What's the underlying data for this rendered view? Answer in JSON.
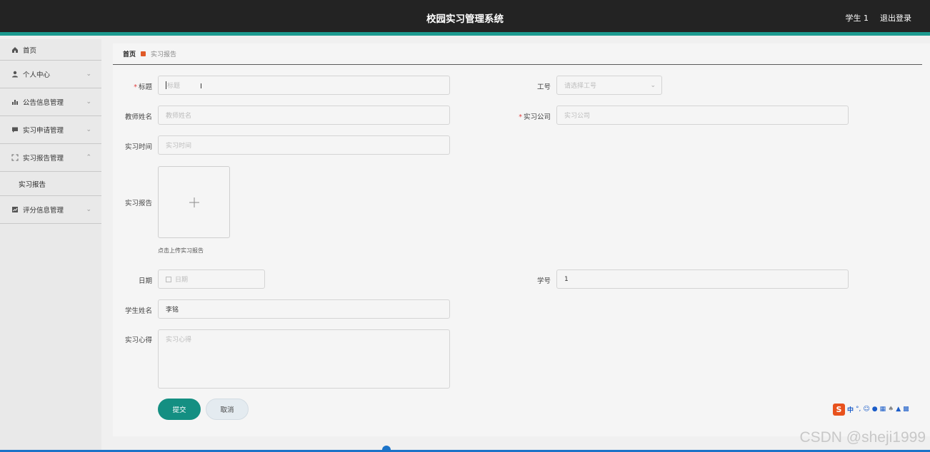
{
  "header": {
    "title": "校园实习管理系统",
    "user": "学生 1",
    "logout": "退出登录"
  },
  "sidebar": {
    "items": [
      {
        "label": "首页",
        "icon": "home-icon"
      },
      {
        "label": "个人中心",
        "icon": "user-icon"
      },
      {
        "label": "公告信息管理",
        "icon": "bar-chart-icon"
      },
      {
        "label": "实习申请管理",
        "icon": "message-icon"
      },
      {
        "label": "实习报告管理",
        "icon": "fullscreen-icon"
      },
      {
        "label": "实习报告"
      },
      {
        "label": "评分信息管理",
        "icon": "chart-icon"
      }
    ]
  },
  "breadcrumb": {
    "home": "首页",
    "current": "实习报告"
  },
  "form": {
    "title_label": "标题",
    "title_placeholder": "标题",
    "job_no_label": "工号",
    "job_no_placeholder": "请选择工号",
    "teacher_label": "教师姓名",
    "teacher_placeholder": "教师姓名",
    "company_label": "实习公司",
    "company_placeholder": "实习公司",
    "time_label": "实习时间",
    "time_placeholder": "实习时间",
    "report_label": "实习报告",
    "upload_hint": "点击上传实习报告",
    "date_label": "日期",
    "date_placeholder": "日期",
    "student_no_label": "学号",
    "student_no_value": "1",
    "student_name_label": "学生姓名",
    "student_name_value": "李铭",
    "experience_label": "实习心得",
    "experience_placeholder": "实习心得",
    "submit": "提交",
    "cancel": "取消",
    "required_mark": "*"
  },
  "ime": {
    "logo": "S",
    "mode": "中"
  },
  "watermark": "CSDN @sheji1999",
  "colors": {
    "topbar": "#232323",
    "accent": "#1b9a8f",
    "primary_button": "#148f82",
    "breadcrumb_marker": "#e05a28"
  }
}
